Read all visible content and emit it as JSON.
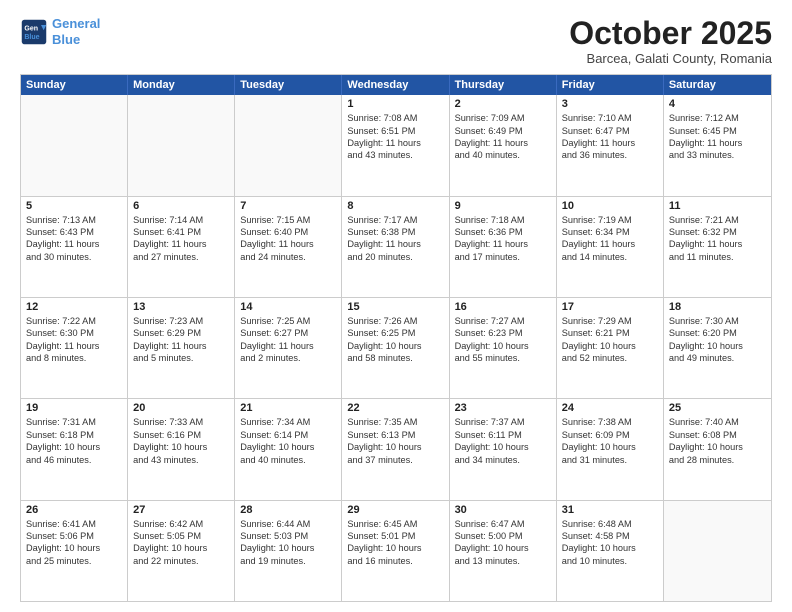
{
  "header": {
    "logo_line1": "General",
    "logo_line2": "Blue",
    "month": "October 2025",
    "location": "Barcea, Galati County, Romania"
  },
  "days_of_week": [
    "Sunday",
    "Monday",
    "Tuesday",
    "Wednesday",
    "Thursday",
    "Friday",
    "Saturday"
  ],
  "weeks": [
    [
      {
        "day": "",
        "lines": []
      },
      {
        "day": "",
        "lines": []
      },
      {
        "day": "",
        "lines": []
      },
      {
        "day": "1",
        "lines": [
          "Sunrise: 7:08 AM",
          "Sunset: 6:51 PM",
          "Daylight: 11 hours",
          "and 43 minutes."
        ]
      },
      {
        "day": "2",
        "lines": [
          "Sunrise: 7:09 AM",
          "Sunset: 6:49 PM",
          "Daylight: 11 hours",
          "and 40 minutes."
        ]
      },
      {
        "day": "3",
        "lines": [
          "Sunrise: 7:10 AM",
          "Sunset: 6:47 PM",
          "Daylight: 11 hours",
          "and 36 minutes."
        ]
      },
      {
        "day": "4",
        "lines": [
          "Sunrise: 7:12 AM",
          "Sunset: 6:45 PM",
          "Daylight: 11 hours",
          "and 33 minutes."
        ]
      }
    ],
    [
      {
        "day": "5",
        "lines": [
          "Sunrise: 7:13 AM",
          "Sunset: 6:43 PM",
          "Daylight: 11 hours",
          "and 30 minutes."
        ]
      },
      {
        "day": "6",
        "lines": [
          "Sunrise: 7:14 AM",
          "Sunset: 6:41 PM",
          "Daylight: 11 hours",
          "and 27 minutes."
        ]
      },
      {
        "day": "7",
        "lines": [
          "Sunrise: 7:15 AM",
          "Sunset: 6:40 PM",
          "Daylight: 11 hours",
          "and 24 minutes."
        ]
      },
      {
        "day": "8",
        "lines": [
          "Sunrise: 7:17 AM",
          "Sunset: 6:38 PM",
          "Daylight: 11 hours",
          "and 20 minutes."
        ]
      },
      {
        "day": "9",
        "lines": [
          "Sunrise: 7:18 AM",
          "Sunset: 6:36 PM",
          "Daylight: 11 hours",
          "and 17 minutes."
        ]
      },
      {
        "day": "10",
        "lines": [
          "Sunrise: 7:19 AM",
          "Sunset: 6:34 PM",
          "Daylight: 11 hours",
          "and 14 minutes."
        ]
      },
      {
        "day": "11",
        "lines": [
          "Sunrise: 7:21 AM",
          "Sunset: 6:32 PM",
          "Daylight: 11 hours",
          "and 11 minutes."
        ]
      }
    ],
    [
      {
        "day": "12",
        "lines": [
          "Sunrise: 7:22 AM",
          "Sunset: 6:30 PM",
          "Daylight: 11 hours",
          "and 8 minutes."
        ]
      },
      {
        "day": "13",
        "lines": [
          "Sunrise: 7:23 AM",
          "Sunset: 6:29 PM",
          "Daylight: 11 hours",
          "and 5 minutes."
        ]
      },
      {
        "day": "14",
        "lines": [
          "Sunrise: 7:25 AM",
          "Sunset: 6:27 PM",
          "Daylight: 11 hours",
          "and 2 minutes."
        ]
      },
      {
        "day": "15",
        "lines": [
          "Sunrise: 7:26 AM",
          "Sunset: 6:25 PM",
          "Daylight: 10 hours",
          "and 58 minutes."
        ]
      },
      {
        "day": "16",
        "lines": [
          "Sunrise: 7:27 AM",
          "Sunset: 6:23 PM",
          "Daylight: 10 hours",
          "and 55 minutes."
        ]
      },
      {
        "day": "17",
        "lines": [
          "Sunrise: 7:29 AM",
          "Sunset: 6:21 PM",
          "Daylight: 10 hours",
          "and 52 minutes."
        ]
      },
      {
        "day": "18",
        "lines": [
          "Sunrise: 7:30 AM",
          "Sunset: 6:20 PM",
          "Daylight: 10 hours",
          "and 49 minutes."
        ]
      }
    ],
    [
      {
        "day": "19",
        "lines": [
          "Sunrise: 7:31 AM",
          "Sunset: 6:18 PM",
          "Daylight: 10 hours",
          "and 46 minutes."
        ]
      },
      {
        "day": "20",
        "lines": [
          "Sunrise: 7:33 AM",
          "Sunset: 6:16 PM",
          "Daylight: 10 hours",
          "and 43 minutes."
        ]
      },
      {
        "day": "21",
        "lines": [
          "Sunrise: 7:34 AM",
          "Sunset: 6:14 PM",
          "Daylight: 10 hours",
          "and 40 minutes."
        ]
      },
      {
        "day": "22",
        "lines": [
          "Sunrise: 7:35 AM",
          "Sunset: 6:13 PM",
          "Daylight: 10 hours",
          "and 37 minutes."
        ]
      },
      {
        "day": "23",
        "lines": [
          "Sunrise: 7:37 AM",
          "Sunset: 6:11 PM",
          "Daylight: 10 hours",
          "and 34 minutes."
        ]
      },
      {
        "day": "24",
        "lines": [
          "Sunrise: 7:38 AM",
          "Sunset: 6:09 PM",
          "Daylight: 10 hours",
          "and 31 minutes."
        ]
      },
      {
        "day": "25",
        "lines": [
          "Sunrise: 7:40 AM",
          "Sunset: 6:08 PM",
          "Daylight: 10 hours",
          "and 28 minutes."
        ]
      }
    ],
    [
      {
        "day": "26",
        "lines": [
          "Sunrise: 6:41 AM",
          "Sunset: 5:06 PM",
          "Daylight: 10 hours",
          "and 25 minutes."
        ]
      },
      {
        "day": "27",
        "lines": [
          "Sunrise: 6:42 AM",
          "Sunset: 5:05 PM",
          "Daylight: 10 hours",
          "and 22 minutes."
        ]
      },
      {
        "day": "28",
        "lines": [
          "Sunrise: 6:44 AM",
          "Sunset: 5:03 PM",
          "Daylight: 10 hours",
          "and 19 minutes."
        ]
      },
      {
        "day": "29",
        "lines": [
          "Sunrise: 6:45 AM",
          "Sunset: 5:01 PM",
          "Daylight: 10 hours",
          "and 16 minutes."
        ]
      },
      {
        "day": "30",
        "lines": [
          "Sunrise: 6:47 AM",
          "Sunset: 5:00 PM",
          "Daylight: 10 hours",
          "and 13 minutes."
        ]
      },
      {
        "day": "31",
        "lines": [
          "Sunrise: 6:48 AM",
          "Sunset: 4:58 PM",
          "Daylight: 10 hours",
          "and 10 minutes."
        ]
      },
      {
        "day": "",
        "lines": []
      }
    ]
  ]
}
